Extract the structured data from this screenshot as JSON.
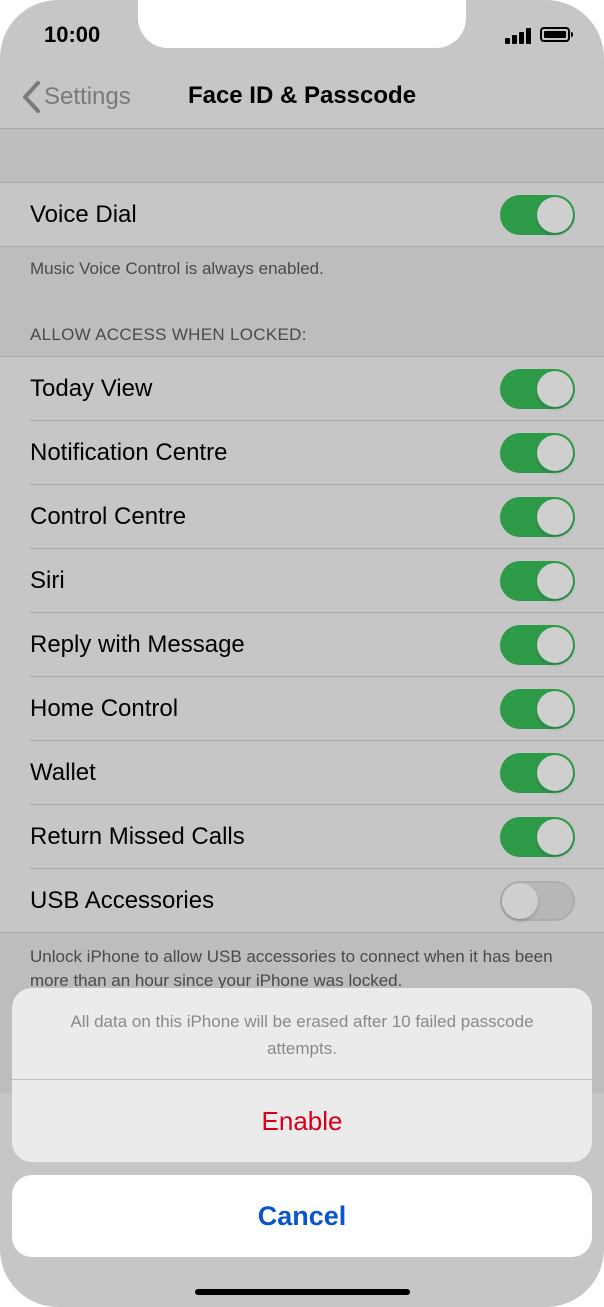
{
  "status_bar": {
    "time": "10:00"
  },
  "nav": {
    "back_label": "Settings",
    "title": "Face ID & Passcode"
  },
  "voice_dial": {
    "label": "Voice Dial",
    "on": true,
    "note": "Music Voice Control is always enabled."
  },
  "locked_section": {
    "header": "ALLOW ACCESS WHEN LOCKED:",
    "items": [
      {
        "label": "Today View",
        "on": true
      },
      {
        "label": "Notification Centre",
        "on": true
      },
      {
        "label": "Control Centre",
        "on": true
      },
      {
        "label": "Siri",
        "on": true
      },
      {
        "label": "Reply with Message",
        "on": true
      },
      {
        "label": "Home Control",
        "on": true
      },
      {
        "label": "Wallet",
        "on": true
      },
      {
        "label": "Return Missed Calls",
        "on": true
      },
      {
        "label": "USB Accessories",
        "on": false
      }
    ],
    "footer": "Unlock iPhone to allow USB accessories to connect when it has been more than an hour since your iPhone was locked."
  },
  "action_sheet": {
    "message": "All data on this iPhone will be erased after 10 failed passcode attempts.",
    "enable_label": "Enable",
    "cancel_label": "Cancel"
  },
  "colors": {
    "toggle_on": "#2e9b48",
    "destructive": "#d3001c",
    "cancel_text": "#0a55c8"
  }
}
